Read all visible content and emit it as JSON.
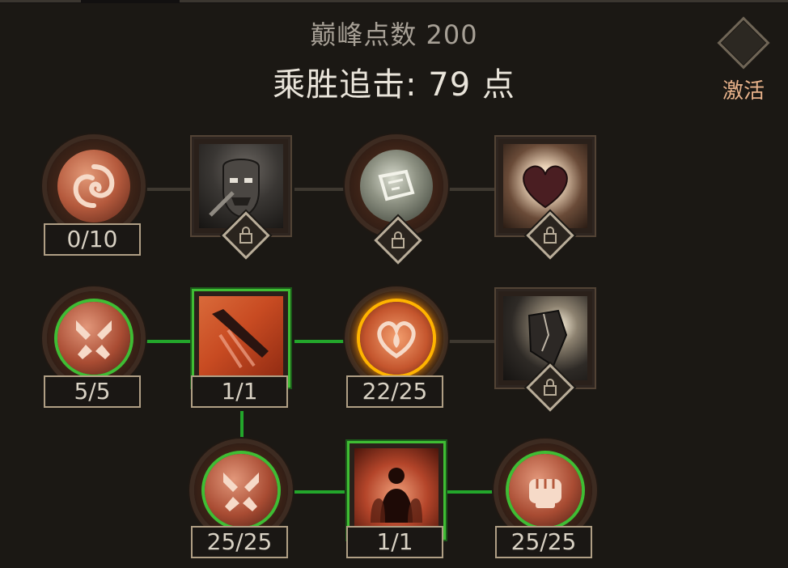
{
  "header": {
    "points_label": "巅峰点数 200",
    "title": "乘胜追击: 79 点"
  },
  "activate": {
    "label": "激活",
    "icon": "diamond-icon"
  },
  "nodes": [
    {
      "id": "n1",
      "icon": "swirl-icon",
      "shape": "circle",
      "counter": "0/10",
      "locked": false,
      "active": false
    },
    {
      "id": "n2",
      "icon": "warrior-icon",
      "shape": "square",
      "locked": true,
      "active": false
    },
    {
      "id": "n3",
      "icon": "scroll-icon",
      "shape": "circle",
      "locked": true,
      "active": false
    },
    {
      "id": "n4",
      "icon": "heart-icon",
      "shape": "square",
      "locked": true,
      "active": false
    },
    {
      "id": "n5",
      "icon": "crossed-blades-icon",
      "shape": "circle",
      "counter": "5/5",
      "active": true
    },
    {
      "id": "n6",
      "icon": "dagger-icon",
      "shape": "square",
      "counter": "1/1",
      "active": true
    },
    {
      "id": "n7",
      "icon": "blood-heart-icon",
      "shape": "circle",
      "counter": "22/25",
      "active": true
    },
    {
      "id": "n8",
      "icon": "broken-shield-icon",
      "shape": "square",
      "locked": true,
      "active": false
    },
    {
      "id": "n9",
      "icon": "crossed-blades-icon",
      "shape": "circle",
      "counter": "25/25",
      "active": true
    },
    {
      "id": "n10",
      "icon": "rally-icon",
      "shape": "square",
      "counter": "1/1",
      "active": true
    },
    {
      "id": "n11",
      "icon": "fist-icon",
      "shape": "circle",
      "counter": "25/25",
      "active": true
    }
  ],
  "colors": {
    "active_link": "#23a62b",
    "inactive_link": "#3e3830",
    "accent_gold": "#ffb400",
    "activate_text": "#e8b28a"
  }
}
